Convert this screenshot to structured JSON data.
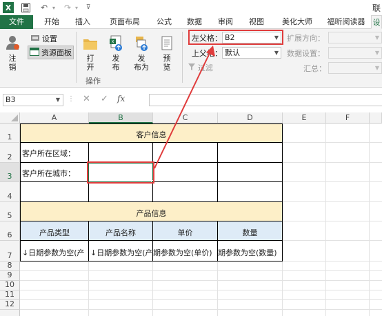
{
  "title_bar": {
    "app_name": "联"
  },
  "tabs": [
    "文件",
    "开始",
    "插入",
    "页面布局",
    "公式",
    "数据",
    "审阅",
    "视图",
    "美化大师",
    "福昕阅读器"
  ],
  "ribbon": {
    "settings_label": "设置",
    "resource_panel_label": "资源面板",
    "logout_label": "注\n销",
    "open_label": "打\n开",
    "publish_label": "发\n布",
    "publish_as_label": "发\n布为",
    "preview_label": "预\n览",
    "group_operation": "操作",
    "left_parent_label": "左父格：",
    "left_parent_value": "B2",
    "top_parent_label": "上父格：",
    "top_parent_value": "默认",
    "filter_label": "过滤",
    "expand_dir_label": "扩展方向：",
    "data_setting_label": "数据设置：",
    "summary_label": "汇总："
  },
  "formula_bar": {
    "cell_ref": "B3",
    "fx": "fx"
  },
  "columns": [
    "A",
    "B",
    "C",
    "D",
    "E",
    "F"
  ],
  "rows": [
    "1",
    "2",
    "3",
    "4",
    "5",
    "6",
    "7",
    "8",
    "9",
    "10",
    "11",
    "12"
  ],
  "sheet": {
    "customer_info": "客户信息",
    "region_label": "客户所在区域：",
    "city_label": "客户所在城市：",
    "product_info": "产品信息",
    "headers": [
      "产品类型",
      "产品名称",
      "单价",
      "数量"
    ],
    "data_cells": [
      "↓日期参数为空(产",
      "↓日期参数为空(产",
      "期参数为空(单价)",
      "期参数为空(数量)"
    ]
  },
  "colors": {
    "excel_green": "#217346",
    "header_fill": "#fdefc8",
    "table_header_fill": "#deebf7",
    "highlight_red": "#e03c3c"
  }
}
